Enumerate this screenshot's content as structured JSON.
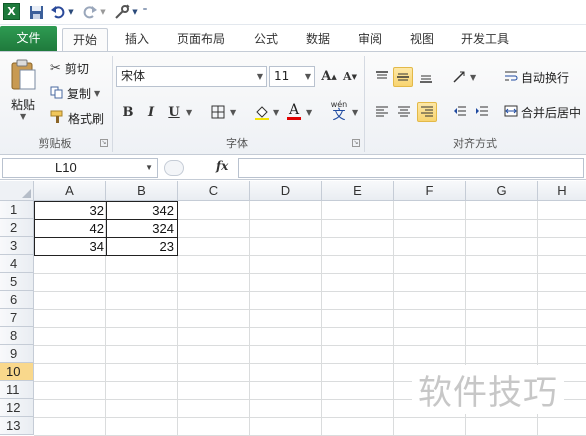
{
  "qat": {
    "app_icon_letter": "X",
    "icons": [
      "save-icon",
      "undo-icon",
      "redo-icon",
      "customize-icon",
      "qat-menu-icon"
    ]
  },
  "tabs": {
    "file": "文件",
    "items": [
      "开始",
      "插入",
      "页面布局",
      "公式",
      "数据",
      "审阅",
      "视图",
      "开发工具"
    ],
    "active": "开始"
  },
  "ribbon": {
    "clipboard": {
      "paste": "粘贴",
      "cut": "剪切",
      "copy": "复制",
      "format_painter": "格式刷",
      "label": "剪贴板"
    },
    "font": {
      "font_name": "宋体",
      "font_size": "11",
      "bold": "B",
      "italic": "I",
      "underline": "U",
      "font_color_glyph": "A",
      "phonetic": "wén",
      "phonetic_char": "文",
      "label": "字体"
    },
    "alignment": {
      "wrap_text": "自动换行",
      "merge_center": "合并后居中",
      "label": "对齐方式"
    },
    "accent_color": "#f8d470",
    "file_tab_color": "#1f7a3c"
  },
  "formula_bar": {
    "name_box": "L10",
    "fx": "fx",
    "value": ""
  },
  "grid": {
    "columns": [
      "A",
      "B",
      "C",
      "D",
      "E",
      "F",
      "G",
      "H"
    ],
    "rows": [
      "1",
      "2",
      "3",
      "4",
      "5",
      "6",
      "7",
      "8",
      "9",
      "10",
      "11",
      "12",
      "13"
    ],
    "selected_row": "10",
    "cells": {
      "A1": "32",
      "B1": "342",
      "A2": "42",
      "B2": "324",
      "A3": "34",
      "B3": "23"
    }
  },
  "watermark": "软件技巧"
}
